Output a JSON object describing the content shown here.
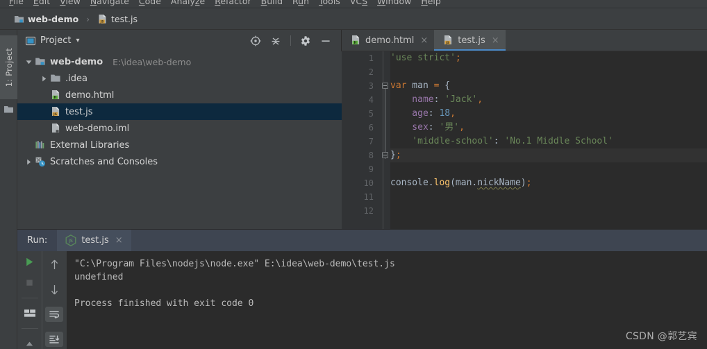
{
  "menu": {
    "items": [
      {
        "label": "File",
        "mnemonic": "F"
      },
      {
        "label": "Edit",
        "mnemonic": "E"
      },
      {
        "label": "View",
        "mnemonic": "V"
      },
      {
        "label": "Navigate",
        "mnemonic": "N"
      },
      {
        "label": "Code",
        "mnemonic": "C"
      },
      {
        "label": "Analyze",
        "mnemonic": "z"
      },
      {
        "label": "Refactor",
        "mnemonic": "R"
      },
      {
        "label": "Build",
        "mnemonic": "B"
      },
      {
        "label": "Run",
        "mnemonic": "u"
      },
      {
        "label": "Tools",
        "mnemonic": "T"
      },
      {
        "label": "VCS",
        "mnemonic": "S"
      },
      {
        "label": "Window",
        "mnemonic": "W"
      },
      {
        "label": "Help",
        "mnemonic": "H"
      }
    ]
  },
  "breadcrumb": {
    "project": "web-demo",
    "separator": "›",
    "file": "test.js"
  },
  "left_strip": {
    "tab_label": "1: Project"
  },
  "project_panel": {
    "title": "Project",
    "chevron": "▾",
    "tools": [
      "locate-icon",
      "collapse-all-icon",
      "settings-gear-icon",
      "hide-icon"
    ],
    "tree": [
      {
        "label": "web-demo",
        "path": "E:\\idea\\web-demo",
        "icon": "module-folder-icon",
        "indent": 0,
        "arrow": "expanded",
        "bold": true,
        "selected": false
      },
      {
        "label": ".idea",
        "path": "",
        "icon": "folder-icon",
        "indent": 1,
        "arrow": "collapsed",
        "bold": false,
        "selected": false
      },
      {
        "label": "demo.html",
        "path": "",
        "icon": "html-file-icon",
        "indent": 1,
        "arrow": "none",
        "bold": false,
        "selected": false
      },
      {
        "label": "test.js",
        "path": "",
        "icon": "js-file-icon",
        "indent": 1,
        "arrow": "none",
        "bold": false,
        "selected": true
      },
      {
        "label": "web-demo.iml",
        "path": "",
        "icon": "iml-file-icon",
        "indent": 1,
        "arrow": "none",
        "bold": false,
        "selected": false
      },
      {
        "label": "External Libraries",
        "path": "",
        "icon": "libraries-icon",
        "indent": 0,
        "arrow": "none",
        "bold": false,
        "selected": false
      },
      {
        "label": "Scratches and Consoles",
        "path": "",
        "icon": "scratches-icon",
        "indent": 0,
        "arrow": "collapsed",
        "bold": false,
        "selected": false
      }
    ]
  },
  "editor": {
    "tabs": [
      {
        "label": "demo.html",
        "icon": "html-file-icon",
        "active": false,
        "close": "×"
      },
      {
        "label": "test.js",
        "icon": "js-file-icon",
        "active": true,
        "close": "×"
      }
    ],
    "caret_line": 8,
    "lines": [
      {
        "n": 1,
        "tokens": [
          {
            "t": "'use strict'",
            "c": "tk-str"
          },
          {
            "t": ";",
            "c": "tk-kw"
          }
        ],
        "indent": 0
      },
      {
        "n": 2,
        "tokens": [],
        "indent": 0
      },
      {
        "n": 3,
        "tokens": [
          {
            "t": "var",
            "c": "tk-kw"
          },
          {
            "t": " man ",
            "c": "tk-def"
          },
          {
            "t": "=",
            "c": "tk-kw"
          },
          {
            "t": " {",
            "c": "tk-def"
          }
        ],
        "indent": 0
      },
      {
        "n": 4,
        "tokens": [
          {
            "t": "    name",
            "c": "tk-prop"
          },
          {
            "t": ":",
            "c": "tk-def"
          },
          {
            "t": " ",
            "c": "tk-def"
          },
          {
            "t": "'Jack'",
            "c": "tk-str"
          },
          {
            "t": ",",
            "c": "tk-kw"
          }
        ],
        "indent": 0
      },
      {
        "n": 5,
        "tokens": [
          {
            "t": "    age",
            "c": "tk-prop"
          },
          {
            "t": ":",
            "c": "tk-def"
          },
          {
            "t": " ",
            "c": "tk-def"
          },
          {
            "t": "18",
            "c": "tk-num"
          },
          {
            "t": ",",
            "c": "tk-kw"
          }
        ],
        "indent": 0
      },
      {
        "n": 6,
        "tokens": [
          {
            "t": "    sex",
            "c": "tk-prop"
          },
          {
            "t": ":",
            "c": "tk-def"
          },
          {
            "t": " ",
            "c": "tk-def"
          },
          {
            "t": "'男'",
            "c": "tk-str"
          },
          {
            "t": ",",
            "c": "tk-kw"
          }
        ],
        "indent": 0
      },
      {
        "n": 7,
        "tokens": [
          {
            "t": "    'middle-school'",
            "c": "tk-str"
          },
          {
            "t": ":",
            "c": "tk-def"
          },
          {
            "t": " ",
            "c": "tk-def"
          },
          {
            "t": "'No.1 Middle School'",
            "c": "tk-str"
          }
        ],
        "indent": 0
      },
      {
        "n": 8,
        "tokens": [
          {
            "t": "}",
            "c": "tk-def"
          },
          {
            "t": ";",
            "c": "tk-kw"
          }
        ],
        "indent": 0
      },
      {
        "n": 9,
        "tokens": [],
        "indent": 0
      },
      {
        "n": 10,
        "tokens": [
          {
            "t": "console",
            "c": "tk-def"
          },
          {
            "t": ".",
            "c": "tk-def"
          },
          {
            "t": "log",
            "c": "tk-fn"
          },
          {
            "t": "(man.",
            "c": "tk-def"
          },
          {
            "t": "nickName",
            "c": "tk-def squig"
          },
          {
            "t": ")",
            "c": "tk-def"
          },
          {
            "t": ";",
            "c": "tk-kw"
          }
        ],
        "indent": 0
      },
      {
        "n": 11,
        "tokens": [],
        "indent": 0
      },
      {
        "n": 12,
        "tokens": [],
        "indent": 0
      }
    ]
  },
  "run_panel": {
    "label": "Run:",
    "tab": {
      "label": "test.js",
      "icon": "nodejs-icon",
      "close": "×"
    },
    "toolbar_left": [
      "run-icon",
      "stop-icon",
      "layout-icon"
    ],
    "toolbar_right": [
      "up-arrow-icon",
      "down-arrow-icon",
      "soft-wrap-icon",
      "scroll-to-end-icon"
    ],
    "console": [
      "\"C:\\Program Files\\nodejs\\node.exe\" E:\\idea\\web-demo\\test.js",
      "undefined",
      "",
      "Process finished with exit code 0"
    ]
  },
  "watermark": "CSDN @郭艺宾",
  "colors": {
    "panel_bg": "#3c3f41",
    "editor_bg": "#2b2b2b",
    "gutter_bg": "#313335",
    "selection_bg": "#0d293e",
    "active_tab_bg": "#4e5254",
    "tab_underline": "#4a88c7",
    "run_header_bg": "#3e4551",
    "keyword": "#cc7832",
    "string": "#6a8759",
    "number": "#6897bb",
    "property": "#9876aa",
    "function": "#ffc66d",
    "default_text": "#a9b7c6",
    "run_green": "#499c54"
  }
}
